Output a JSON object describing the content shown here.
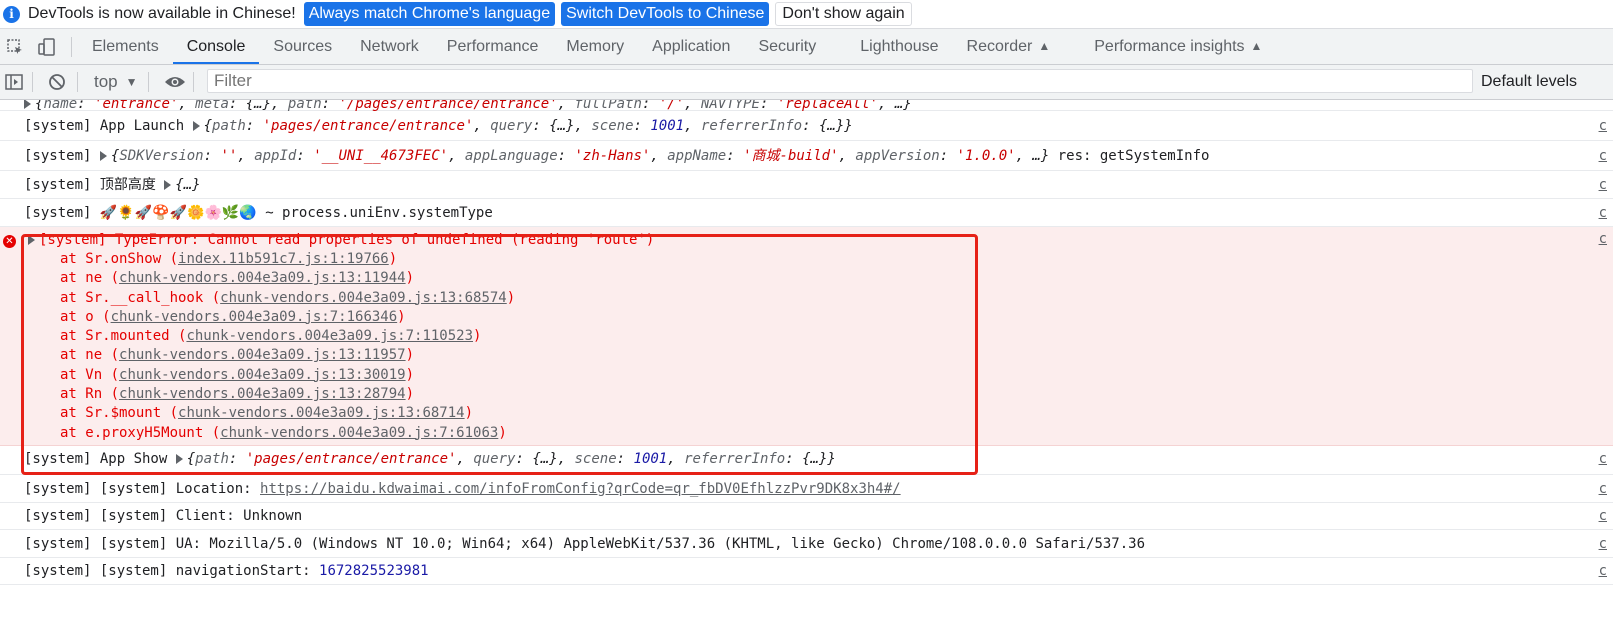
{
  "infobar": {
    "icon": "info-icon",
    "message": "DevTools is now available in Chinese!",
    "btn_match": "Always match Chrome's language",
    "btn_switch": "Switch DevTools to Chinese",
    "btn_dismiss": "Don't show again"
  },
  "tabs": {
    "elements": "Elements",
    "console": "Console",
    "sources": "Sources",
    "network": "Network",
    "performance": "Performance",
    "memory": "Memory",
    "application": "Application",
    "security": "Security",
    "lighthouse": "Lighthouse",
    "recorder": "Recorder",
    "perf_insights": "Performance insights"
  },
  "toolbar": {
    "context": "top",
    "filter_placeholder": "Filter",
    "levels": "Default levels"
  },
  "console": {
    "row0": {
      "k1": "name",
      "v1": "'entrance'",
      "k2": "meta",
      "v2": "{…}",
      "k3": "path",
      "v3": "'/pages/entrance/entrance'",
      "k4": "fullPath",
      "v4": "'/'",
      "k5": "NAVTYPE",
      "v5": "'replaceAll'",
      "tail": "…}"
    },
    "row1": {
      "prefix": "[system] App Launch",
      "k1": "path",
      "v1": "'pages/entrance/entrance'",
      "k2": "query",
      "v2": "{…}",
      "k3": "scene",
      "v3": "1001",
      "k4": "referrerInfo",
      "v4": "{…}}"
    },
    "row2": {
      "prefix": "[system]",
      "k1": "SDKVersion",
      "v1": "''",
      "k2": "appId",
      "v2": "'__UNI__4673FEC'",
      "k3": "appLanguage",
      "v3": "'zh-Hans'",
      "k4": "appName",
      "v4": "'商城-build'",
      "k5": "appVersion",
      "v5": "'1.0.0'",
      "tail": "…}",
      "suffix": "res: getSystemInfo"
    },
    "row3": {
      "prefix": "[system] 顶部高度",
      "obj": "{…}"
    },
    "row4": {
      "prefix": "[system]",
      "emoji": "🚀🌻🚀🍄🚀🌼🌸🌿🌏",
      "text": "~ process.uniEnv.systemType"
    },
    "error": {
      "message": "[system] TypeError: Cannot read properties of undefined (reading 'route')",
      "stack": [
        {
          "fn": "at Sr.onShow (",
          "loc": "index.11b591c7.js:1:19766"
        },
        {
          "fn": "at ne (",
          "loc": "chunk-vendors.004e3a09.js:13:11944"
        },
        {
          "fn": "at Sr.__call_hook (",
          "loc": "chunk-vendors.004e3a09.js:13:68574"
        },
        {
          "fn": "at o (",
          "loc": "chunk-vendors.004e3a09.js:7:166346"
        },
        {
          "fn": "at Sr.mounted (",
          "loc": "chunk-vendors.004e3a09.js:7:110523"
        },
        {
          "fn": "at ne (",
          "loc": "chunk-vendors.004e3a09.js:13:11957"
        },
        {
          "fn": "at Vn (",
          "loc": "chunk-vendors.004e3a09.js:13:30019"
        },
        {
          "fn": "at Rn (",
          "loc": "chunk-vendors.004e3a09.js:13:28794"
        },
        {
          "fn": "at Sr.$mount (",
          "loc": "chunk-vendors.004e3a09.js:13:68714"
        },
        {
          "fn": "at e.proxyH5Mount (",
          "loc": "chunk-vendors.004e3a09.js:7:61063"
        }
      ],
      "close": ")"
    },
    "row_show": {
      "prefix": "[system] App Show",
      "k1": "path",
      "v1": "'pages/entrance/entrance'",
      "k2": "query",
      "v2": "{…}",
      "k3": "scene",
      "v3": "1001",
      "k4": "referrerInfo",
      "v4": "{…}}"
    },
    "row_location": {
      "prefix": "[system] [system] Location:",
      "url": "https://baidu.kdwaimai.com/infoFromConfig?qrCode=qr_fbDV0EfhlzzPvr9DK8x3h4#/"
    },
    "row_client": {
      "text": "[system] [system] Client: Unknown"
    },
    "row_ua": {
      "text": "[system] [system] UA: Mozilla/5.0 (Windows NT 10.0; Win64; x64) AppleWebKit/537.36 (KHTML, like Gecko) Chrome/108.0.0.0 Safari/537.36"
    },
    "row_nav": {
      "prefix": "[system] [system] navigationStart:",
      "value": "1672825523981"
    },
    "source_mark": "c"
  }
}
